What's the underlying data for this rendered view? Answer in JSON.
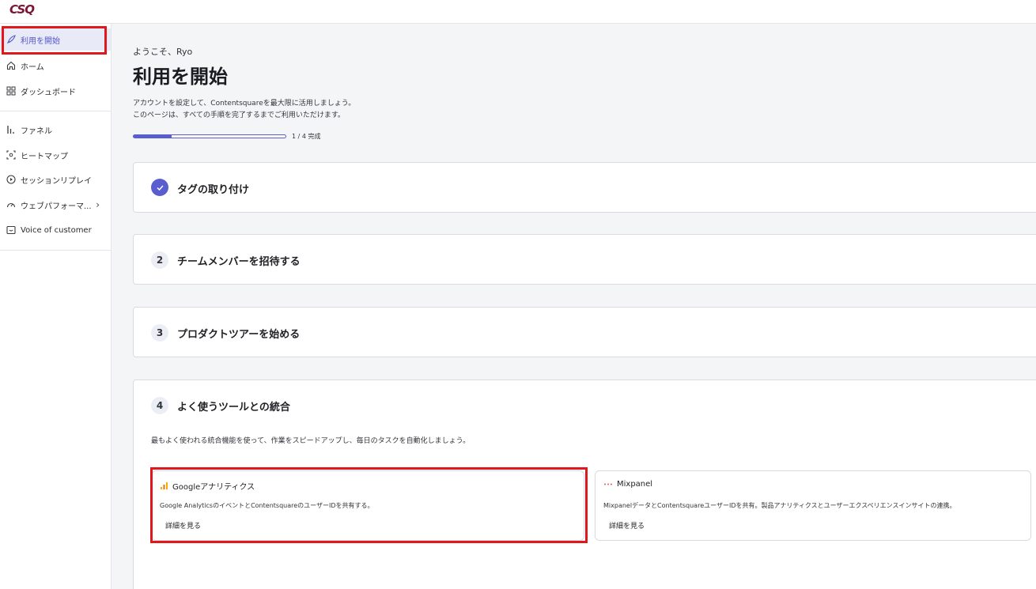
{
  "app": {
    "logo_text": "CSQ",
    "brand_color": "#7b1634"
  },
  "sidebar": {
    "items": [
      {
        "label": "利用を開始",
        "icon": "rocket-icon",
        "active": true
      },
      {
        "label": "ホーム",
        "icon": "home-icon"
      },
      {
        "label": "ダッシュボード",
        "icon": "dashboard-icon"
      },
      {
        "label": "ファネル",
        "icon": "funnel-bars-icon"
      },
      {
        "label": "ヒートマップ",
        "icon": "heatmap-icon"
      },
      {
        "label": "セッションリプレイ",
        "icon": "play-circle-icon"
      },
      {
        "label": "ウェブパフォーマ...",
        "icon": "gauge-icon",
        "chevron": "chevron-right-icon"
      },
      {
        "label": "Voice of customer",
        "icon": "feedback-icon"
      }
    ]
  },
  "header": {
    "welcome": "ようこそ、Ryo",
    "title": "利用を開始",
    "desc_line1": "アカウントを設定して、Contentsquareを最大限に活用しましょう。",
    "desc_line2": "このページは、すべての手順を完了するまでご利用いただけます。",
    "progress_text": "1 / 4 完成",
    "progress_fraction": 0.25,
    "accent_color": "#5a5dd0"
  },
  "steps": [
    {
      "number": "✓",
      "title": "タグの取り付け",
      "done": true
    },
    {
      "number": "2",
      "title": "チームメンバーを招待する"
    },
    {
      "number": "3",
      "title": "プロダクトツアーを始める"
    },
    {
      "number": "4",
      "title": "よく使うツールとの統合",
      "desc": "最もよく使われる統合機能を使って、作業をスピードアップし、毎日のタスクを自動化しましょう。"
    }
  ],
  "tools": [
    {
      "name": "Googleアナリティクス",
      "icon": "google-analytics-icon",
      "desc": "Google AnalyticsのイベントとContentsquareのユーザーIDを共有する。",
      "link": "詳細を見る"
    },
    {
      "name": "Mixpanel",
      "icon": "mixpanel-icon",
      "desc": "MixpanelデータとContentsquareユーザーIDを共有。製品アナリティクスとユーザーエクスペリエンスインサイトの連携。",
      "link": "詳細を見る"
    }
  ],
  "highlight_color": "#e0181b"
}
